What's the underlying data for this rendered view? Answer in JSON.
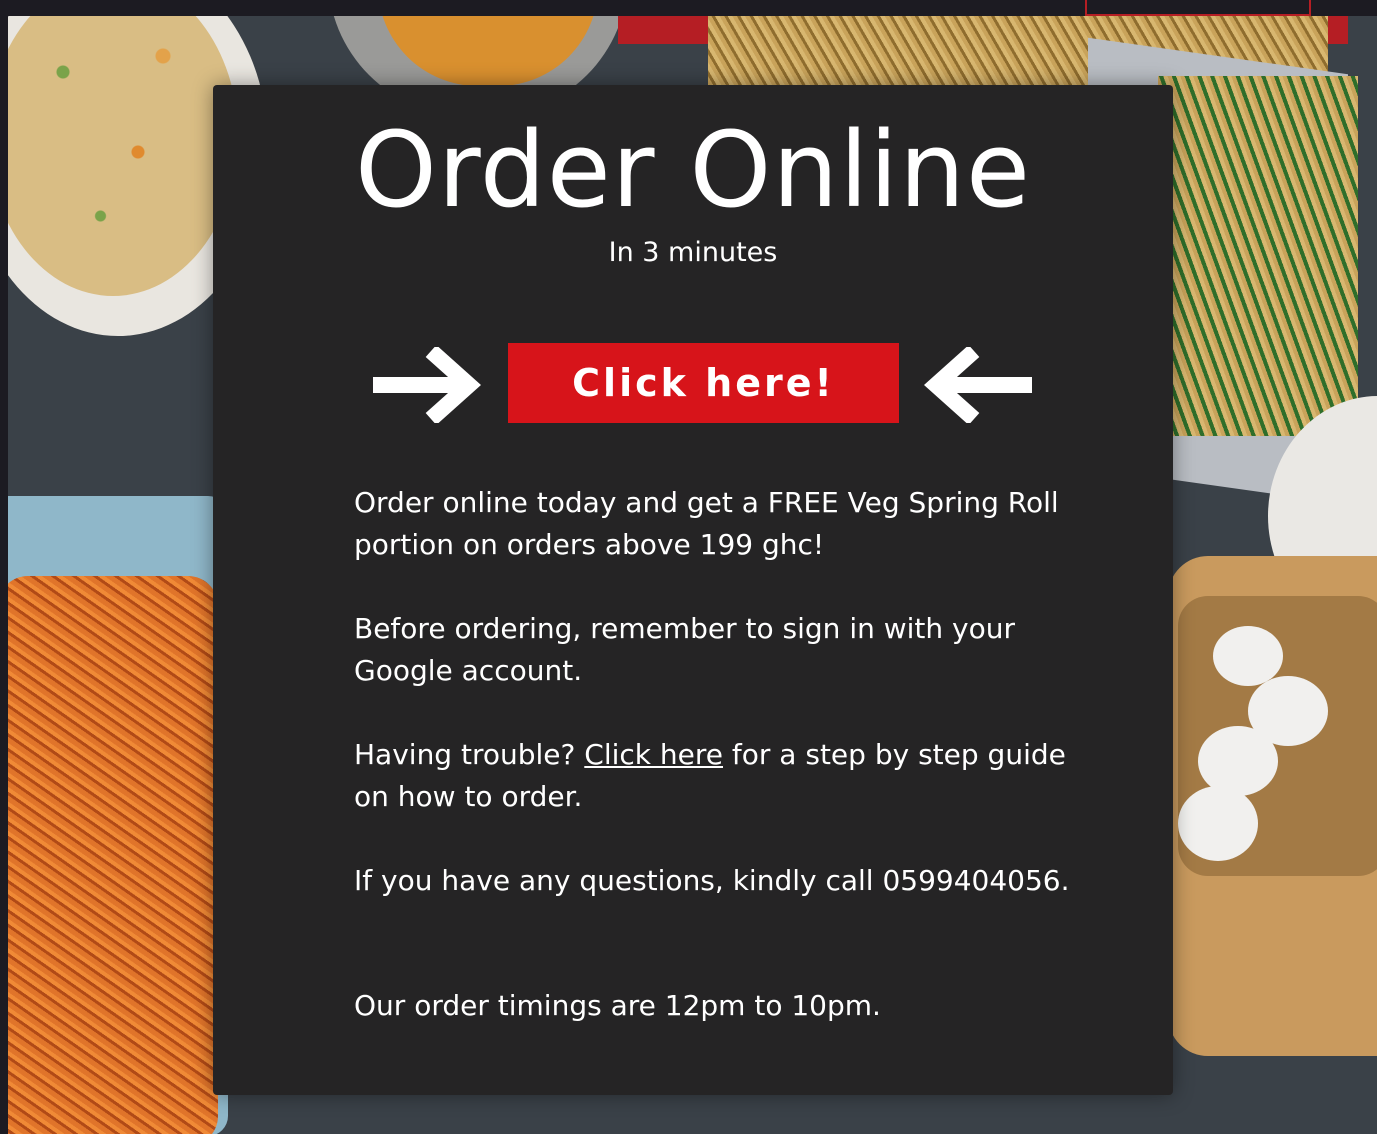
{
  "header": {
    "title": "Order Online",
    "subtitle": "In 3 minutes"
  },
  "cta": {
    "label": "Click here!"
  },
  "paragraphs": {
    "offer": "Order online today and get a FREE Veg Spring Roll portion on orders above 199 ghc!",
    "signin": "Before ordering, remember to sign in with your Google account.",
    "trouble_before": "Having trouble?",
    "trouble_link": "Click here",
    "trouble_after": "for a step by step guide on how to order.",
    "questions": "If you have any questions, kindly call 0599404056.",
    "timings": "Our order timings are 12pm to 10pm."
  },
  "colors": {
    "card_background": "#252425",
    "cta_background": "#d7141a",
    "text": "#ffffff"
  },
  "icons": {
    "left_arrow": "arrow-right-icon",
    "right_arrow": "arrow-left-icon"
  }
}
